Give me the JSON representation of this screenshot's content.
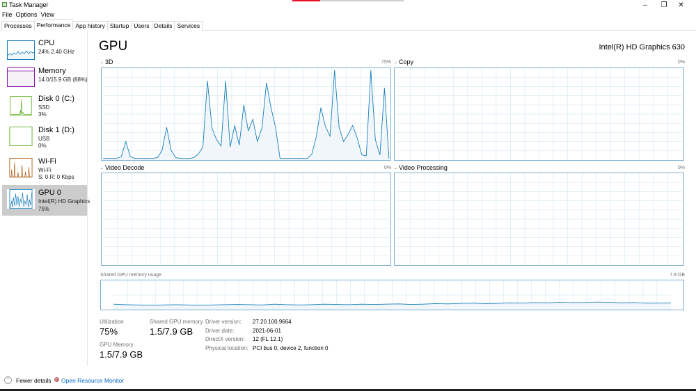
{
  "window": {
    "title": "Task Manager",
    "minimize": "–",
    "maximize": "❐",
    "close": "✕",
    "accent_colors": [
      "#e81123",
      "#cfcfcf"
    ]
  },
  "menu": [
    "File",
    "Options",
    "View"
  ],
  "tabs": [
    {
      "label": "Processes",
      "active": false
    },
    {
      "label": "Performance",
      "active": true
    },
    {
      "label": "App history",
      "active": false
    },
    {
      "label": "Startup",
      "active": false
    },
    {
      "label": "Users",
      "active": false
    },
    {
      "label": "Details",
      "active": false
    },
    {
      "label": "Services",
      "active": false
    }
  ],
  "sidebar": {
    "items": [
      {
        "title": "CPU",
        "line1": "24%  2.40 GHz",
        "line2": "",
        "color": "#117dbb",
        "fill": "#f1f6fa",
        "selected": false,
        "icon": "cpu-graph"
      },
      {
        "title": "Memory",
        "line1": "14.0/15.9 GB (88%)",
        "line2": "",
        "color": "#8b12ae",
        "fill": "#f4f2f4",
        "selected": false,
        "icon": "memory-graph"
      },
      {
        "title": "Disk 0 (C:)",
        "line1": "SSD",
        "line2": "3%",
        "color": "#4da60c",
        "fill": "#eff7f2",
        "selected": false,
        "icon": "disk-graph"
      },
      {
        "title": "Disk 1 (D:)",
        "line1": "USB",
        "line2": "0%",
        "color": "#4da60c",
        "fill": "#eff7f2",
        "selected": false,
        "icon": "disk-graph"
      },
      {
        "title": "Wi-Fi",
        "line1": "Wi-Fi",
        "line2": "S: 0  R: 0 Kbps",
        "color": "#a74f01",
        "fill": "#fcf3eb",
        "selected": false,
        "icon": "network-graph"
      },
      {
        "title": "GPU 0",
        "line1": "Intel(R) HD Graphics",
        "line2": "75%",
        "color": "#117dbb",
        "fill": "#f1f6fa",
        "selected": true,
        "icon": "gpu-graph"
      }
    ]
  },
  "main": {
    "title": "GPU",
    "device_name": "Intel(R) HD Graphics 630",
    "graph_color": "#117dbb",
    "graph_fill": "#f1f6fa",
    "grid_color": "#d9eaf4",
    "panels": [
      {
        "label": "3D",
        "pct": "75%"
      },
      {
        "label": "Copy",
        "pct": "0%"
      },
      {
        "label": "Video Decode",
        "pct": "0%"
      },
      {
        "label": "Video Processing",
        "pct": "0%"
      }
    ],
    "shared_memory": {
      "label": "Shared GPU memory usage",
      "max": "7.9 GB"
    },
    "stats": {
      "utilization_label": "Utilization",
      "utilization_value": "75%",
      "shared_label": "Shared GPU memory",
      "shared_value": "1.5/7.9 GB",
      "gpu_memory_label": "GPU Memory",
      "gpu_memory_value": "1.5/7.9 GB"
    },
    "info": [
      {
        "label": "Driver version:",
        "value": "27.20.100.9664"
      },
      {
        "label": "Driver date:",
        "value": "2021-06-01"
      },
      {
        "label": "DirectX version:",
        "value": "12 (FL 12.1)"
      },
      {
        "label": "Physical location:",
        "value": "PCI bus 0, device 2, function 0"
      }
    ]
  },
  "footer": {
    "fewer_details": "Fewer details",
    "fewer_icon": "⌃",
    "monitor_link": "Open Resource Monitor",
    "link_color": "#0066cc"
  },
  "graphs": {
    "3d_samples": [
      1,
      1,
      1,
      1,
      3,
      20,
      3,
      1,
      1,
      1,
      1,
      1,
      2,
      10,
      36,
      10,
      2,
      1,
      1,
      1,
      2,
      6,
      14,
      88,
      35,
      22,
      15,
      88,
      14,
      38,
      16,
      61,
      32,
      45,
      20,
      35,
      86,
      58,
      36,
      1,
      1,
      1,
      1,
      1,
      1,
      1,
      6,
      26,
      58,
      37,
      26,
      100,
      36,
      20,
      28,
      38,
      24,
      5,
      4,
      100,
      22,
      5,
      80,
      1
    ],
    "shared_memory_samples": [
      18,
      16,
      15,
      14,
      15,
      16,
      15,
      14,
      15,
      16,
      17,
      16,
      15,
      18,
      16,
      15,
      16,
      18,
      17,
      16,
      18,
      17,
      18,
      19,
      17,
      18,
      20,
      19,
      21,
      22,
      20,
      21,
      23,
      22,
      24,
      23,
      25,
      24,
      24,
      26,
      25,
      23,
      24,
      22,
      22,
      23
    ]
  }
}
